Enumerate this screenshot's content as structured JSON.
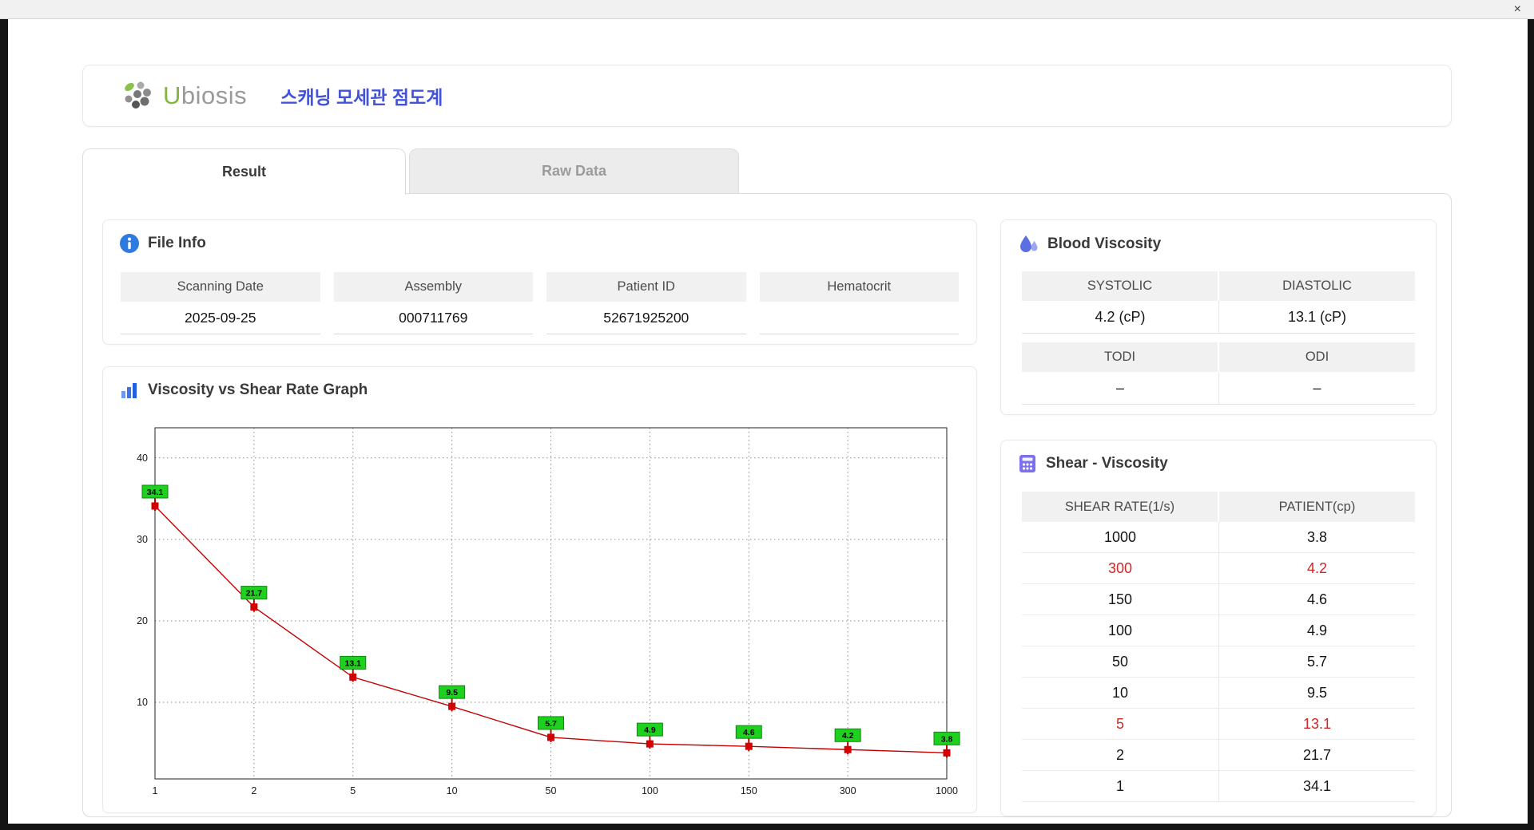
{
  "window": {
    "close_label": "×"
  },
  "header": {
    "logo_u": "U",
    "logo_rest": "biosis",
    "title": "스캐닝 모세관 점도계"
  },
  "tabs": [
    {
      "label": "Result"
    },
    {
      "label": "Raw Data"
    }
  ],
  "file_info": {
    "title": "File Info",
    "fields": [
      {
        "label": "Scanning Date",
        "value": "2025-09-25"
      },
      {
        "label": "Assembly",
        "value": "000711769"
      },
      {
        "label": "Patient ID",
        "value": "52671925200"
      },
      {
        "label": "Hematocrit",
        "value": ""
      }
    ]
  },
  "blood_viscosity": {
    "title": "Blood Viscosity",
    "row1": [
      {
        "label": "SYSTOLIC",
        "value": "4.2 (cP)"
      },
      {
        "label": "DIASTOLIC",
        "value": "13.1 (cP)"
      }
    ],
    "row2": [
      {
        "label": "TODI",
        "value": "–"
      },
      {
        "label": "ODI",
        "value": "–"
      }
    ]
  },
  "graph": {
    "title": "Viscosity vs Shear Rate Graph"
  },
  "chart_data": {
    "type": "line",
    "title": "Viscosity vs Shear Rate Graph",
    "x": [
      1,
      2,
      5,
      10,
      50,
      100,
      150,
      300,
      1000
    ],
    "values": [
      34.1,
      21.7,
      13.1,
      9.5,
      5.7,
      4.9,
      4.6,
      4.2,
      3.8
    ],
    "x_scale": "categorical-equal-spacing",
    "xlabel": "",
    "ylabel": "",
    "yticks": [
      10,
      20,
      30,
      40
    ],
    "ylim": [
      0.6,
      43.7
    ],
    "grid": "dotted",
    "line_color": "#c40000",
    "marker_color": "#d40000",
    "label_bg": "#1ed11e",
    "legend": "none"
  },
  "shear_table": {
    "title": "Shear - Viscosity",
    "headers": [
      "SHEAR RATE(1/s)",
      "PATIENT(cp)"
    ],
    "rows": [
      {
        "shear": "1000",
        "patient": "3.8",
        "highlight": false
      },
      {
        "shear": "300",
        "patient": "4.2",
        "highlight": true
      },
      {
        "shear": "150",
        "patient": "4.6",
        "highlight": false
      },
      {
        "shear": "100",
        "patient": "4.9",
        "highlight": false
      },
      {
        "shear": "50",
        "patient": "5.7",
        "highlight": false
      },
      {
        "shear": "10",
        "patient": "9.5",
        "highlight": false
      },
      {
        "shear": "5",
        "patient": "13.1",
        "highlight": true
      },
      {
        "shear": "2",
        "patient": "21.7",
        "highlight": false
      },
      {
        "shear": "1",
        "patient": "34.1",
        "highlight": false
      }
    ]
  }
}
